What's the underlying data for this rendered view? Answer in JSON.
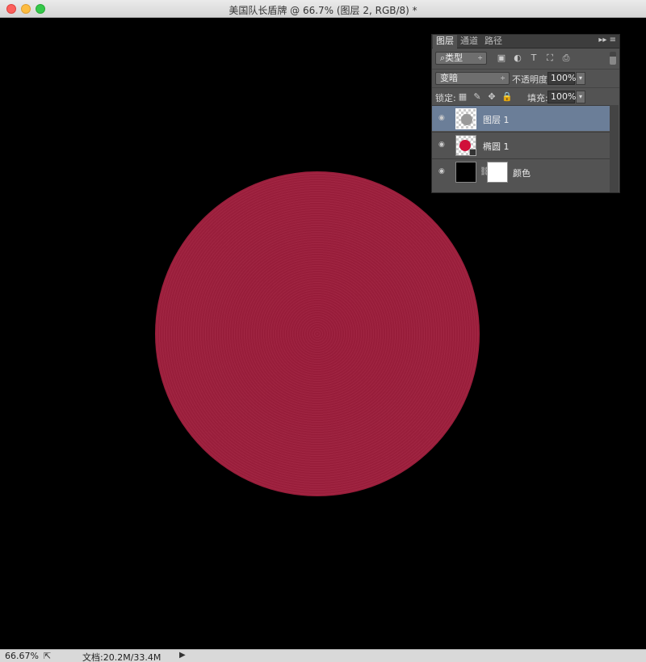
{
  "window": {
    "title": "美国队长盾牌 @ 66.7% (图层 2, RGB/8) *"
  },
  "panel": {
    "tabs": [
      "图层",
      "通道",
      "路径"
    ],
    "menu_glyph": "▸▸ ≡",
    "filter": {
      "label": "⌕类型",
      "arrow": "÷"
    },
    "filter_icons": [
      "▣",
      "◐",
      "T",
      "⛶",
      "⎙"
    ],
    "blend_mode": {
      "label": "变暗",
      "arrow": "÷"
    },
    "opacity": {
      "label": "不透明度:",
      "value": "100%",
      "arrow": "▾"
    },
    "lock": {
      "label": "锁定:",
      "icons": [
        "▦",
        "✎",
        "✥",
        "🔒"
      ]
    },
    "fill": {
      "label": "填充:",
      "value": "100%",
      "arrow": "▾"
    },
    "layers": [
      {
        "name": "图层 1",
        "selected": true,
        "eye": "◉"
      },
      {
        "name": "椭圆 1",
        "selected": false,
        "eye": "◉"
      },
      {
        "name": "颜色",
        "selected": false,
        "eye": "◉",
        "link": "⛓"
      }
    ]
  },
  "status": {
    "zoom": "66.67%",
    "share_glyph": "⇱",
    "doc": "文档:20.2M/33.4M",
    "play_glyph": "▶"
  },
  "colors": {
    "shield_red": "#9e1f3d",
    "selected_layer": "#6b7e98"
  }
}
